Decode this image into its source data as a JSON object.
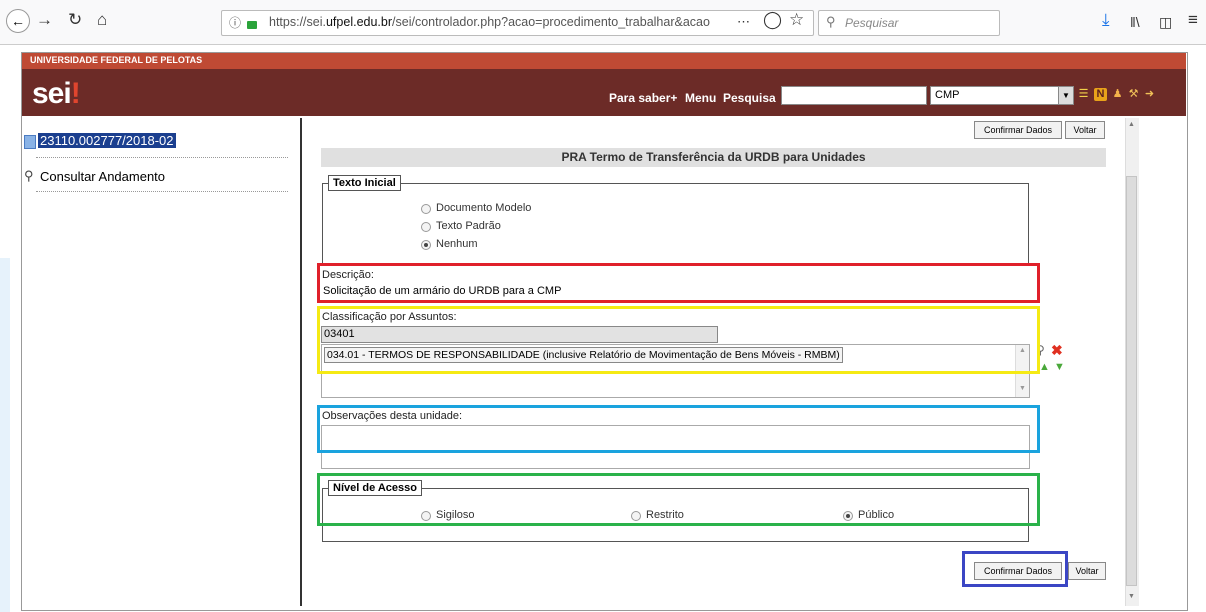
{
  "browser": {
    "url_prefix": "https://sei.",
    "url_domain": "ufpel.edu.br",
    "url_path": "/sei/controlador.php?acao=procedimento_trabalhar&acao",
    "page_actions": "⋯",
    "search_placeholder": "Pesquisar"
  },
  "institution": "UNIVERSIDADE FEDERAL DE PELOTAS",
  "logo": {
    "text": "sei",
    "mark": "!"
  },
  "header": {
    "links": [
      "Para saber+",
      "Menu",
      "Pesquisa"
    ],
    "search_value": "",
    "unit_selected": "CMP"
  },
  "sidebar": {
    "process_number": "23110.002777/2018-02",
    "consult_label": "Consultar Andamento"
  },
  "form": {
    "confirm_label": "Confirmar Dados",
    "back_label": "Voltar",
    "title": "PRA Termo de Transferência da URDB para Unidades",
    "initial_text": {
      "legend": "Texto Inicial",
      "options": [
        "Documento Modelo",
        "Texto Padrão",
        "Nenhum"
      ],
      "selected": "Nenhum"
    },
    "description": {
      "label": "Descrição:",
      "value": "Solicitação de um armário do URDB para a CMP"
    },
    "classification": {
      "label": "Classificação por Assuntos:",
      "code_value": "03401",
      "selected_item": "034.01 - TERMOS DE RESPONSABILIDADE (inclusive Relatório de Movimentação de Bens Móveis - RMBM)"
    },
    "observations": {
      "label": "Observações desta unidade:",
      "value": ""
    },
    "access_level": {
      "legend": "Nível de Acesso",
      "options": [
        "Sigiloso",
        "Restrito",
        "Público"
      ],
      "selected": "Público"
    }
  },
  "highlight_colors": {
    "description": "#e0202a",
    "classification": "#f5ea14",
    "observations": "#1aa3de",
    "access_level": "#2ab24a",
    "confirm_button": "#3b46c4"
  },
  "colors": {
    "top_strip": "#bf4a34",
    "header_bg": "#6c2b27",
    "process_highlight": "#1b3f8f"
  }
}
